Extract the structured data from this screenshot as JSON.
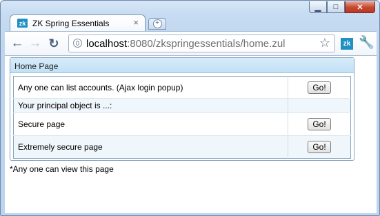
{
  "window": {
    "minimize_icon": "minimize-icon",
    "maximize_icon": "maximize-icon",
    "close_icon": "close-icon"
  },
  "tab": {
    "favicon_text": "zk",
    "title": "ZK Spring Essentials",
    "close_glyph": "×"
  },
  "toolbar": {
    "url_scheme_host": "localhost",
    "url_rest": ":8080/zkspringessentials/home.zul",
    "ext_text": "zk"
  },
  "page": {
    "panel_title": "Home Page",
    "rows": [
      {
        "label": "Any one can list accounts. (Ajax login popup)",
        "button": "Go!"
      },
      {
        "label": "Your principal object is ...:",
        "button": ""
      },
      {
        "label": "Secure page",
        "button": "Go!"
      },
      {
        "label": "Extremely secure page",
        "button": "Go!"
      }
    ],
    "footnote": "*Any one can view this page"
  },
  "colors": {
    "panel_header": "#c1e1f6",
    "border": "#86a4be",
    "alt_row": "#f0f7fc",
    "zk_brand": "#1f8fc4"
  }
}
